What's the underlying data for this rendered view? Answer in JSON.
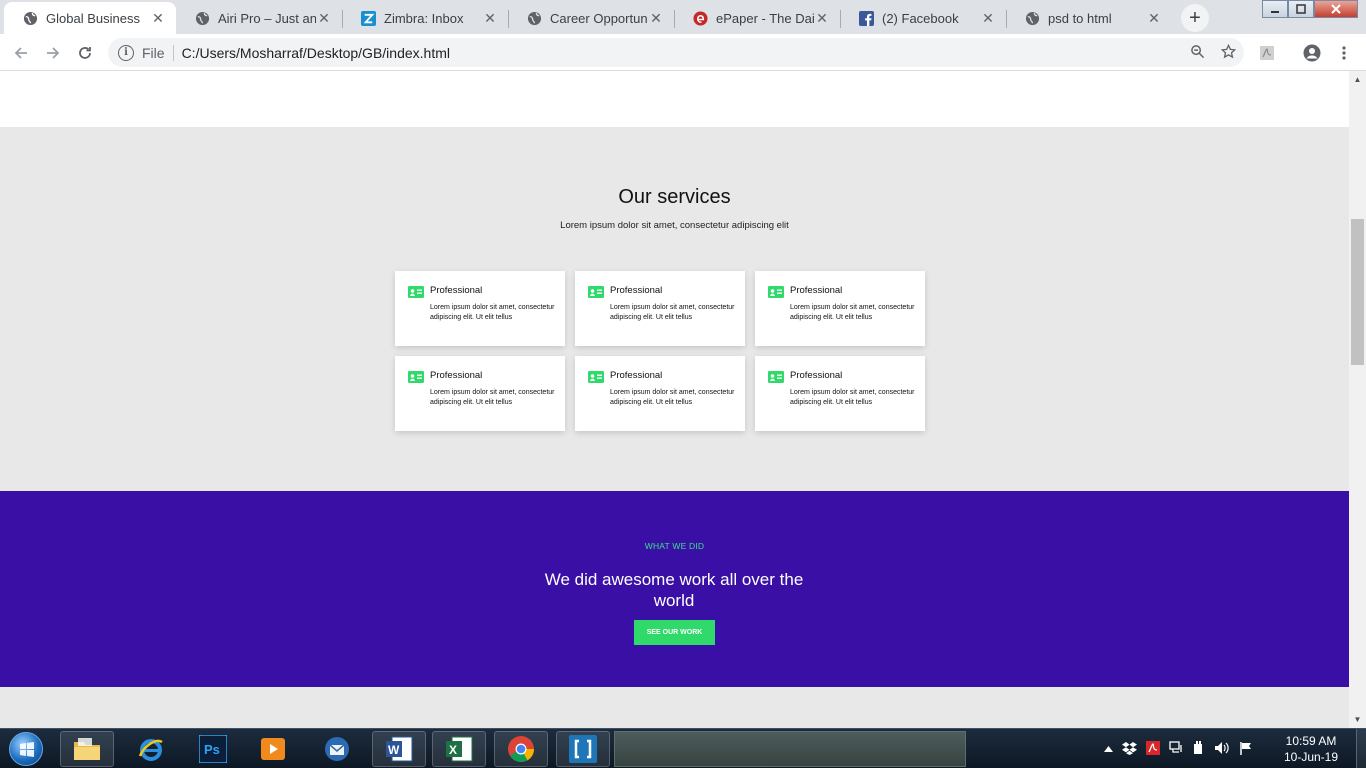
{
  "browser": {
    "tabs": [
      {
        "title": "Global Business",
        "icon": "globe-icon",
        "active": true
      },
      {
        "title": "Airi Pro – Just anoth",
        "icon": "globe-icon",
        "active": false
      },
      {
        "title": "Zimbra: Inbox",
        "icon": "zimbra-icon",
        "active": false
      },
      {
        "title": "Career Opportunity",
        "icon": "globe-icon",
        "active": false
      },
      {
        "title": "ePaper - The Daily",
        "icon": "epaper-icon",
        "active": false
      },
      {
        "title": "(2) Facebook",
        "icon": "facebook-icon",
        "active": false
      },
      {
        "title": "psd to html",
        "icon": "globe-icon",
        "active": false
      }
    ],
    "tab_close_glyph": "✕",
    "new_tab_glyph": "+",
    "address": {
      "scheme_label": "File",
      "url": "C:/Users/Mosharraf/Desktop/GB/index.html"
    }
  },
  "page": {
    "services": {
      "title": "Our services",
      "subtitle": "Lorem ipsum dolor sit amet, consectetur adipiscing elit",
      "cards": [
        {
          "title": "Professional",
          "text": "Lorem ipsum dolor sit amet, consectetur adipiscing elit. Ut elit tellus"
        },
        {
          "title": "Professional",
          "text": "Lorem ipsum dolor sit amet, consectetur adipiscing elit. Ut elit tellus"
        },
        {
          "title": "Professional",
          "text": "Lorem ipsum dolor sit amet, consectetur adipiscing elit. Ut elit tellus"
        },
        {
          "title": "Professional",
          "text": "Lorem ipsum dolor sit amet, consectetur adipiscing elit. Ut elit tellus"
        },
        {
          "title": "Professional",
          "text": "Lorem ipsum dolor sit amet, consectetur adipiscing elit. Ut elit tellus"
        },
        {
          "title": "Professional",
          "text": "Lorem ipsum dolor sit amet, consectetur adipiscing elit. Ut elit tellus"
        }
      ],
      "card_icon": "id-card-icon"
    },
    "what_we_did": {
      "label": "WHAT WE DID",
      "heading": "We did awesome work all over the world",
      "button_label": "SEE OUR WORK"
    }
  },
  "taskbar": {
    "apps": [
      "explorer-icon",
      "internet-explorer-icon",
      "photoshop-icon",
      "media-player-icon",
      "thunderbird-icon",
      "word-icon",
      "excel-icon",
      "chrome-icon",
      "brackets-icon"
    ],
    "photoshop_label": "Ps",
    "word_label": "W",
    "excel_label": "X",
    "clock": {
      "time": "10:59 AM",
      "date": "10-Jun-19"
    }
  },
  "colors": {
    "accent_green": "#2fd96a",
    "purple_band": "#3a0fa5",
    "section_gray": "#e8e8e8"
  }
}
